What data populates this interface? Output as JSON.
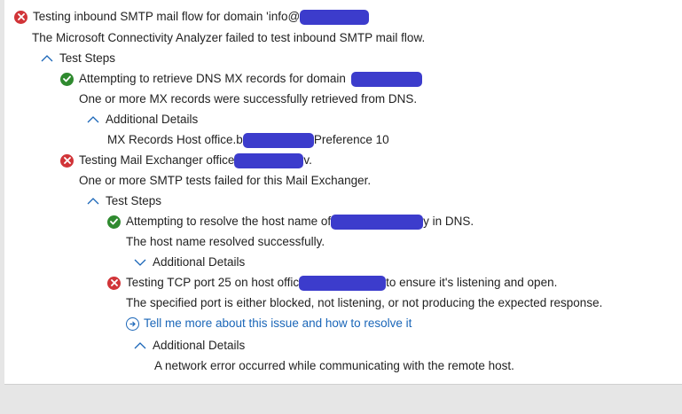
{
  "results": {
    "main_title": "Testing inbound SMTP mail flow for domain 'info@",
    "main_message": "The Microsoft Connectivity Analyzer failed to test inbound SMTP mail flow.",
    "test_steps_label": "Test Steps",
    "dns_mx": {
      "title": "Attempting to retrieve DNS MX records for domain",
      "message": "One or more MX records were successfully retrieved from DNS.",
      "details_label": "Additional Details",
      "details_text_prefix": "MX Records Host office.b",
      "details_text_suffix": "Preference 10"
    },
    "mail_exchanger": {
      "title_prefix": "Testing Mail Exchanger office",
      "title_suffix": "v.",
      "message": "One or more SMTP tests failed for this Mail Exchanger.",
      "test_steps_label": "Test Steps",
      "resolve": {
        "title_prefix": "Attempting to resolve the host name of",
        "title_suffix": "y in DNS.",
        "message": "The host name resolved successfully.",
        "details_label": "Additional Details"
      },
      "tcp": {
        "title_prefix": "Testing TCP port 25 on host offic",
        "title_suffix": "to ensure it's listening and open.",
        "message": "The specified port is either blocked, not listening, or not producing the expected response.",
        "link": "Tell me more about this issue and how to resolve it",
        "details_label": "Additional Details",
        "details_text": "A network error occurred while communicating with the remote host."
      }
    }
  },
  "colors": {
    "error": "#d13438",
    "success": "#2f8a2f",
    "link": "#1a66b8",
    "redaction": "#3c3ccc"
  },
  "icons": {
    "error": "error-icon",
    "success": "success-icon",
    "collapse": "chevron-up-icon",
    "expand": "chevron-down-icon",
    "link": "arrow-circle-right-icon"
  }
}
